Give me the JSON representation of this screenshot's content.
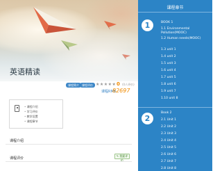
{
  "course": {
    "title": "英语精读",
    "tags": [
      "课程简介",
      "课程评价"
    ],
    "rating_stars": "★★★★★",
    "score": "0",
    "score_note": "(0人评价)",
    "price_label": "课程RMB",
    "price": "82697"
  },
  "info_box": {
    "items": [
      "课程介绍",
      "学习评价",
      "教学设置",
      "课程章节"
    ]
  },
  "sections": {
    "intro": "课程介绍",
    "review": "课程评价",
    "review_button": "我要评价"
  },
  "panel": {
    "title": "课程章节",
    "books": [
      {
        "number": "1",
        "title": "BOOK 1",
        "chapters": [
          "1.1  Environmental Pollution(MOOC)",
          "1.2  Human needs(MOOC)",
          "1.3  unit 1",
          "1.4  unit 2",
          "1.5  unit 3",
          "1.6  unit 4",
          "1.7  unit 5",
          "1.8  unit 6",
          "1.9  unit 7",
          "1.10  unit 8"
        ]
      },
      {
        "number": "2",
        "title": "Book 2",
        "chapters": [
          "2.1  Unit 1",
          "2.2  Unit 2",
          "2.3  Unit 3",
          "2.4  Unit 4",
          "2.5  Unit 5",
          "2.6  Unit 6",
          "2.7  Unit 7",
          "2.8  Unit 8"
        ]
      }
    ]
  },
  "colors": {
    "panel_bg": "#2c84c6",
    "accent_orange": "#f08a00",
    "tag_blue": "#3d87c7"
  }
}
